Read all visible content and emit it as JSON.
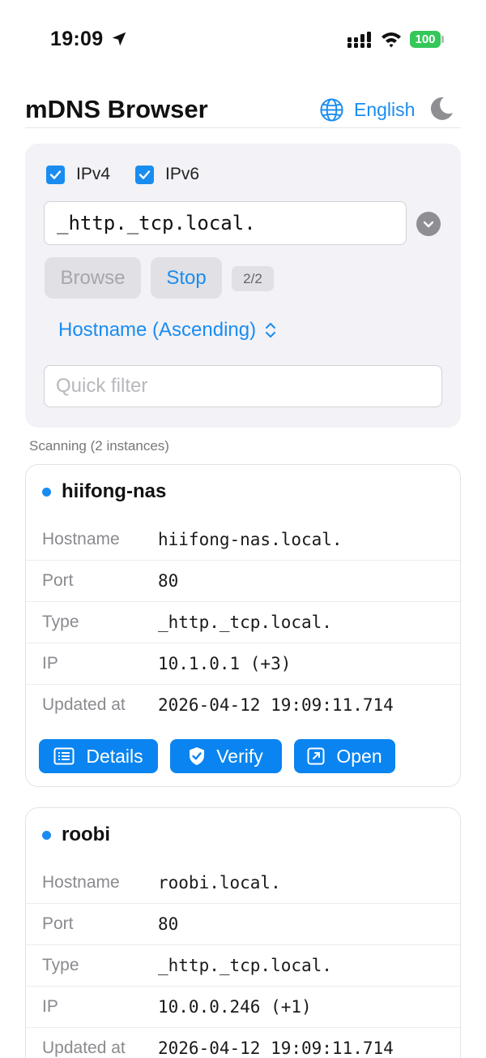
{
  "status_bar": {
    "time": "19:09",
    "battery": "100",
    "icons": [
      "location-arrow-icon",
      "cellular-signal-icon",
      "wifi-icon",
      "battery-icon"
    ]
  },
  "header": {
    "title": "mDNS Browser",
    "language": "English",
    "icons": [
      "globe-icon",
      "moon-icon"
    ]
  },
  "controls": {
    "ipv4_label": "IPv4",
    "ipv4_checked": true,
    "ipv6_label": "IPv6",
    "ipv6_checked": true,
    "service_type": "_http._tcp.local.",
    "browse_label": "Browse",
    "stop_label": "Stop",
    "count": "2/2",
    "sort_label": "Hostname (Ascending)",
    "filter_placeholder": "Quick filter"
  },
  "scan_status": "Scanning (2 instances)",
  "colors": {
    "accent": "#1a8cf0",
    "button": "#0a84f0",
    "battery": "#34c759"
  },
  "results": [
    {
      "name": "hiifong-nas",
      "rows": [
        {
          "key": "Hostname",
          "value": "hiifong-nas.local."
        },
        {
          "key": "Port",
          "value": "80"
        },
        {
          "key": "Type",
          "value": "_http._tcp.local."
        },
        {
          "key": "IP",
          "value": "10.1.0.1 (+3)"
        },
        {
          "key": "Updated at",
          "value": "2026-04-12 19:09:11.714"
        }
      ],
      "actions": {
        "details": "Details",
        "verify": "Verify",
        "open": "Open"
      }
    },
    {
      "name": "roobi",
      "rows": [
        {
          "key": "Hostname",
          "value": "roobi.local."
        },
        {
          "key": "Port",
          "value": "80"
        },
        {
          "key": "Type",
          "value": "_http._tcp.local."
        },
        {
          "key": "IP",
          "value": "10.0.0.246 (+1)"
        },
        {
          "key": "Updated at",
          "value": "2026-04-12 19:09:11.714"
        }
      ]
    }
  ]
}
